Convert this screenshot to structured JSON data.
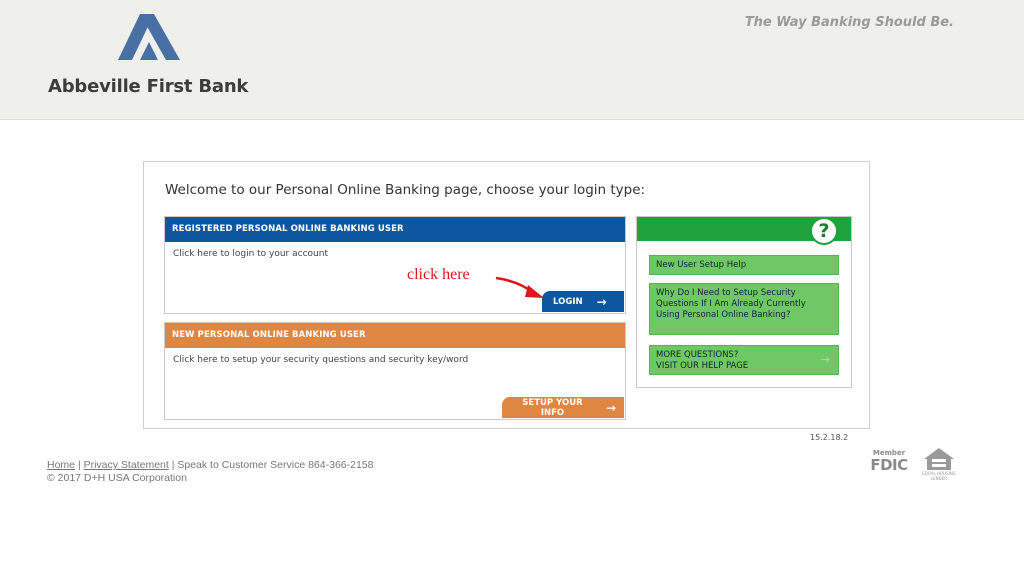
{
  "header": {
    "bank_name": "Abbeville First Bank",
    "tagline": "The Way Banking Should Be.",
    "logo_icon": "abbeville-logo-icon",
    "colors": {
      "background": "#efefec",
      "logo_blue": "#4a6fa5"
    }
  },
  "main": {
    "welcome": "Welcome to our Personal Online Banking page, choose your login type:",
    "registered": {
      "title": "REGISTERED PERSONAL ONLINE BANKING USER",
      "description": "Click here to login to your account",
      "button_label": "LOGIN",
      "button_icon": "arrow-right-icon",
      "color": "#0d56a0"
    },
    "new_user": {
      "title": "NEW PERSONAL ONLINE BANKING USER",
      "description": "Click here to setup your security questions and security key/word",
      "button_label": "SETUP YOUR INFO",
      "button_icon": "arrow-right-icon",
      "color": "#df8642"
    },
    "annotation": {
      "text": "click here",
      "color": "#e0161c",
      "arrow_icon": "red-arrow-icon"
    }
  },
  "help": {
    "icon": "question-mark-icon",
    "color": "#1fa33a",
    "links": [
      {
        "label": "New User Setup Help"
      },
      {
        "label": "Why Do I Need to Setup Security Questions If I Am Already Currently Using Personal Online Banking?"
      },
      {
        "label_line1": "MORE QUESTIONS?",
        "label_line2": "VISIT OUR HELP PAGE",
        "icon": "arrow-right-icon"
      }
    ]
  },
  "version": "15.2.18.2",
  "footer": {
    "home": "Home",
    "separator": "|",
    "privacy": "Privacy Statement",
    "service": "| Speak to Customer Service 864-366-2158",
    "copyright": "© 2017 D+H USA Corporation",
    "fdic_member": "Member",
    "fdic": "FDIC",
    "equal_housing": "EQUAL HOUSING LENDER",
    "equal_housing_icon": "equal-housing-lender-icon"
  }
}
